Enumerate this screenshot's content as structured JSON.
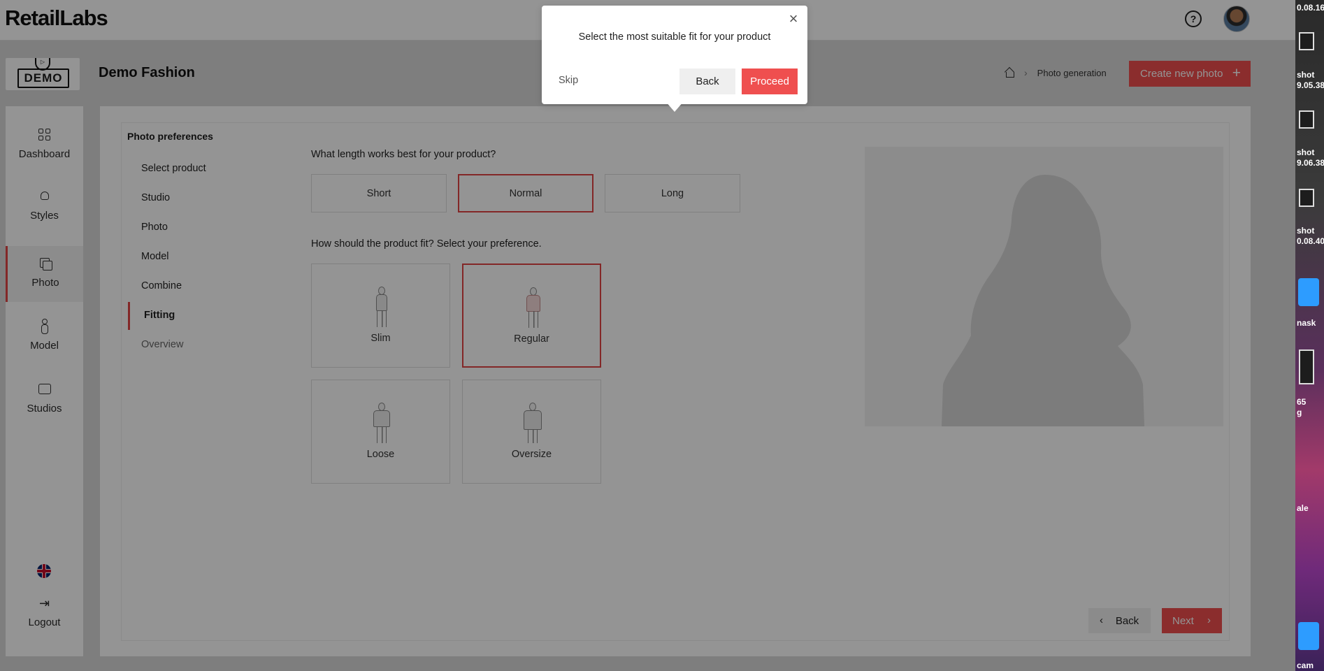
{
  "header": {
    "brand": "RetailLabs",
    "help_icon": "help-circle-icon"
  },
  "subheader": {
    "logo_text": "DEMO",
    "page_title": "Demo Fashion",
    "breadcrumb": {
      "current": "Photo generation"
    },
    "create_button": "Create new photo"
  },
  "sidebar": {
    "items": [
      {
        "label": "Dashboard",
        "icon": "dashboard-icon"
      },
      {
        "label": "Styles",
        "icon": "styles-icon"
      },
      {
        "label": "Photo",
        "icon": "photo-icon",
        "active": true
      },
      {
        "label": "Model",
        "icon": "model-icon"
      },
      {
        "label": "Studios",
        "icon": "studios-icon"
      }
    ],
    "language_icon": "uk-flag-icon",
    "logout": "Logout"
  },
  "steps": {
    "title": "Photo preferences",
    "items": [
      "Select product",
      "Studio",
      "Photo",
      "Model",
      "Combine",
      "Fitting",
      "Overview"
    ],
    "active": "Fitting"
  },
  "length": {
    "question": "What length works best for your product?",
    "options": [
      "Short",
      "Normal",
      "Long"
    ],
    "selected": "Normal"
  },
  "fit": {
    "question": "How should the product fit? Select your preference.",
    "options": [
      "Slim",
      "Regular",
      "Loose",
      "Oversize"
    ],
    "selected": "Regular"
  },
  "footer": {
    "back": "Back",
    "next": "Next"
  },
  "popover": {
    "text": "Select the most suitable fit for your product",
    "skip": "Skip",
    "back": "Back",
    "proceed": "Proceed"
  },
  "desktop": {
    "labels": [
      "0.08.16",
      "shot\n9.05.38",
      "shot\n9.06.38",
      "shot\n0.08.40",
      "nask",
      "65\ng",
      "ale",
      "cam"
    ]
  },
  "colors": {
    "accent": "#ef4f4f",
    "selected_border": "#e24444"
  }
}
